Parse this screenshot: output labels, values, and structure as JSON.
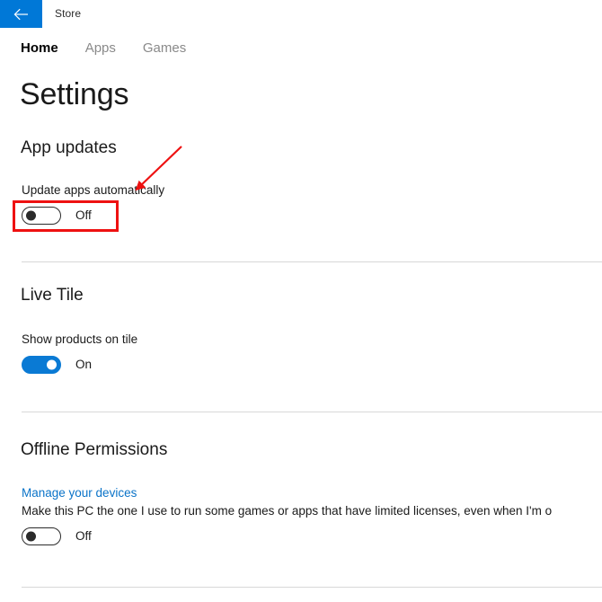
{
  "titlebar": {
    "back_icon": "back-arrow-icon",
    "app_title": "Store",
    "accent_color": "#0078d7"
  },
  "tabs": [
    {
      "label": "Home",
      "active": true
    },
    {
      "label": "Apps",
      "active": false
    },
    {
      "label": "Games",
      "active": false
    }
  ],
  "page": {
    "title": "Settings"
  },
  "sections": {
    "app_updates": {
      "heading": "App updates",
      "setting_label": "Update apps automatically",
      "toggle_state": "Off"
    },
    "live_tile": {
      "heading": "Live Tile",
      "setting_label": "Show products on tile",
      "toggle_state": "On"
    },
    "offline_permissions": {
      "heading": "Offline Permissions",
      "link_label": "Manage your devices",
      "description": "Make this PC the one I use to run some games or apps that have limited licenses, even when I'm o",
      "toggle_state": "Off"
    }
  },
  "annotations": {
    "color": "#ee1111",
    "highlight_target": "update-apps-automatically-toggle",
    "arrow_points_to": "Update apps automatically"
  }
}
